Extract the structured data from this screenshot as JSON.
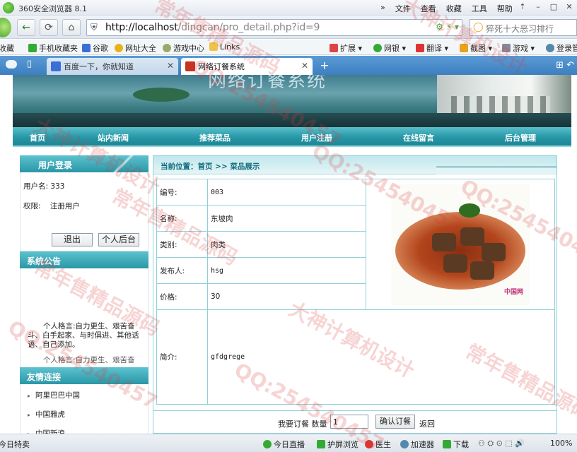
{
  "browser": {
    "app_title": "360安全浏览器 8.1",
    "menus": [
      "»",
      "文件",
      "查看",
      "收藏",
      "工具",
      "帮助"
    ],
    "url_host": "http://localhost",
    "url_path": "/dingcan/pro_detail.php?id=9",
    "search_text": "猝死十大恶习排行",
    "bookmarks": [
      "收藏",
      "手机收藏夹",
      "谷歌",
      "网址大全",
      "游戏中心",
      "Links",
      "扩展",
      "网银",
      "翻译",
      "截图",
      "游戏",
      "登录管"
    ],
    "tabs": [
      {
        "label": "百度一下，你就知道",
        "active": false
      },
      {
        "label": "网络订餐系统",
        "active": true
      }
    ],
    "new_tab_label": "+"
  },
  "site": {
    "title": "网络订餐系统",
    "nav": [
      "首页",
      "站内新闻",
      "推荐菜品",
      "用户注册",
      "在线留言",
      "后台管理"
    ]
  },
  "sidebar": {
    "login_title": "用户登录",
    "username_label": "用户名:",
    "username_value": "333",
    "role_label": "权限:",
    "role_value": "注册用户",
    "logout_button": "退出",
    "backend_button": "个人后台",
    "notice_title": "系统公告",
    "notice_text": "个人格言:自力更生、艰苦奋斗、白手起家、与时俱进、其他话语、自己添加。",
    "notice_text_more": "个人格言:自力更生、艰苦奋",
    "links_title": "友情连接",
    "links": [
      "阿里巴巴中国",
      "中国雅虎",
      "中国新浪"
    ]
  },
  "detail": {
    "breadcrumb": "当前位置：首页  >>  菜品展示",
    "fields": [
      {
        "label": "编号:",
        "value": "003"
      },
      {
        "label": "名称:",
        "value": "东坡肉"
      },
      {
        "label": "类别:",
        "value": "肉类"
      },
      {
        "label": "发布人:",
        "value": "hsg"
      },
      {
        "label": "价格:",
        "value": "30"
      }
    ],
    "intro_label": "简介:",
    "intro_value": "gfdgrege",
    "photo_mark": "中国网",
    "order_label": "我要订餐 数量",
    "order_qty": "1",
    "order_button": "确认订餐",
    "back_link": "返回"
  },
  "statusbar": {
    "left_text": "今日特卖",
    "items": [
      "今日直播",
      "护屏浏览",
      "医生",
      "加速器",
      "下载",
      "100%"
    ]
  },
  "watermarks": [
    "常年售精品源码",
    "大神计算机设计",
    "QQ:254540457"
  ],
  "colors": {
    "nav_teal": "#2797a7",
    "border_teal": "#8fd0d8",
    "tab_strip_blue": "#3d7fc0"
  }
}
